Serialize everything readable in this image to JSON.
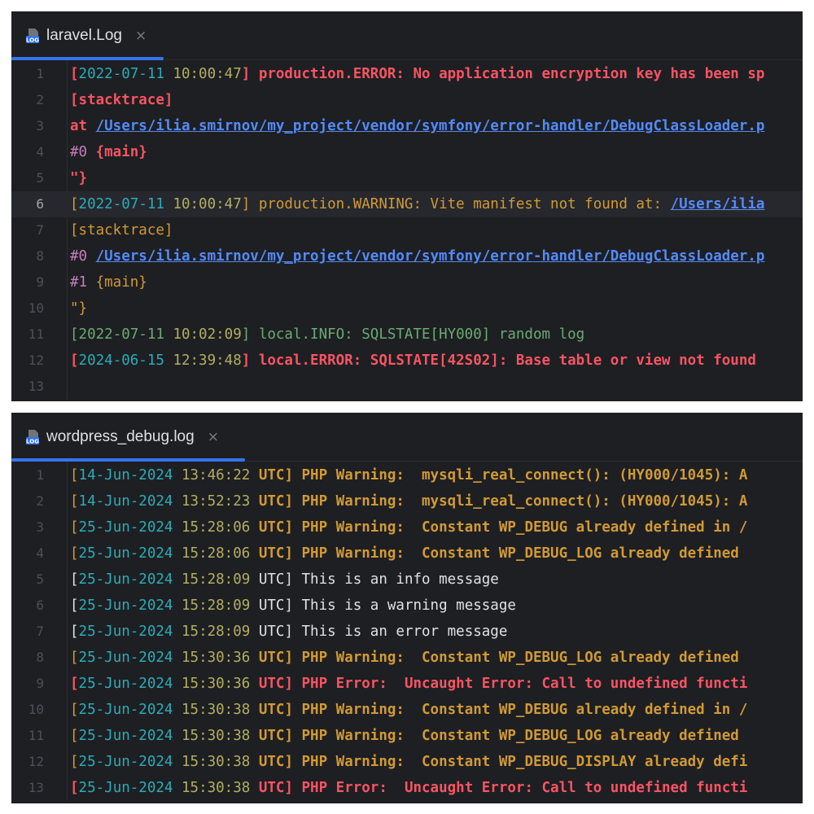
{
  "colors": {
    "panel_bg": "#1e1f22",
    "accent": "#3574f0",
    "error": "#f75464",
    "warning": "#d19a34",
    "info": "#6aab73",
    "date": "#2aacb8",
    "time": "#b3ae60",
    "link": "#548af7",
    "trace_purple": "#c77dbb",
    "plain": "#bcbec4"
  },
  "editors": [
    {
      "tab": {
        "icon": "log-file-icon",
        "name": "laravel.Log",
        "close": "×"
      },
      "current_line": 6,
      "lines": [
        {
          "n": "1",
          "segs": [
            {
              "t": "[",
              "c": "#f75464",
              "b": true
            },
            {
              "t": "2022-07-11",
              "c": "#2aacb8"
            },
            {
              "t": " ",
              "c": "#f75464"
            },
            {
              "t": "10:00:47",
              "c": "#b3ae60"
            },
            {
              "t": "] production.ERROR: No application encryption key has been sp",
              "c": "#f75464",
              "b": true
            }
          ]
        },
        {
          "n": "2",
          "segs": [
            {
              "t": "[stacktrace]",
              "c": "#f75464",
              "b": true
            }
          ]
        },
        {
          "n": "3",
          "segs": [
            {
              "t": "at ",
              "c": "#f75464",
              "b": true
            },
            {
              "t": "/Users/ilia.smirnov/my_project/vendor/symfony/error-handler/DebugClassLoader.p",
              "c": "#548af7",
              "u": true,
              "b": true
            }
          ]
        },
        {
          "n": "4",
          "segs": [
            {
              "t": "#0 ",
              "c": "#c77dbb"
            },
            {
              "t": "{main}",
              "c": "#f75464",
              "b": true
            }
          ]
        },
        {
          "n": "5",
          "segs": [
            {
              "t": "\"}",
              "c": "#f75464",
              "b": true
            }
          ]
        },
        {
          "n": "6",
          "segs": [
            {
              "t": "[",
              "c": "#d19a34"
            },
            {
              "t": "2022-07-11",
              "c": "#2aacb8"
            },
            {
              "t": " ",
              "c": "#d19a34"
            },
            {
              "t": "10:00:47",
              "c": "#b3ae60"
            },
            {
              "t": "] production.WARNING: Vite manifest not found at: ",
              "c": "#d19a34"
            },
            {
              "t": "/Users/ilia",
              "c": "#548af7",
              "u": true,
              "b": true
            }
          ]
        },
        {
          "n": "7",
          "segs": [
            {
              "t": "[stacktrace]",
              "c": "#d19a34"
            }
          ]
        },
        {
          "n": "8",
          "segs": [
            {
              "t": "#0 ",
              "c": "#c77dbb"
            },
            {
              "t": "/Users/ilia.smirnov/my_project/vendor/symfony/error-handler/DebugClassLoader.p",
              "c": "#548af7",
              "u": true,
              "b": true
            }
          ]
        },
        {
          "n": "9",
          "segs": [
            {
              "t": "#1 ",
              "c": "#c77dbb"
            },
            {
              "t": "{main}",
              "c": "#d19a34"
            }
          ]
        },
        {
          "n": "10",
          "segs": [
            {
              "t": "\"}",
              "c": "#d19a34"
            }
          ]
        },
        {
          "n": "11",
          "segs": [
            {
              "t": "[",
              "c": "#6aab73"
            },
            {
              "t": "2022-07-11",
              "c": "#6aab73"
            },
            {
              "t": " ",
              "c": "#6aab73"
            },
            {
              "t": "10:02:09",
              "c": "#b3ae60"
            },
            {
              "t": "] local.INFO: SQLSTATE[HY000] random log",
              "c": "#6aab73"
            }
          ]
        },
        {
          "n": "12",
          "segs": [
            {
              "t": "[",
              "c": "#f75464",
              "b": true
            },
            {
              "t": "2024-06-15",
              "c": "#2aacb8"
            },
            {
              "t": " ",
              "c": "#f75464"
            },
            {
              "t": "12:39:48",
              "c": "#b3ae60"
            },
            {
              "t": "] local.ERROR: SQLSTATE[42S02]: Base table or view not found",
              "c": "#f75464",
              "b": true
            }
          ]
        },
        {
          "n": "13",
          "segs": []
        }
      ]
    },
    {
      "tab": {
        "icon": "log-file-icon",
        "name": "wordpress_debug.log",
        "close": "×"
      },
      "current_line": 0,
      "lines": [
        {
          "n": "1",
          "segs": [
            {
              "t": "[",
              "c": "#d19a34"
            },
            {
              "t": "14-Jun-2024",
              "c": "#2aacb8"
            },
            {
              "t": " ",
              "c": "#d19a34"
            },
            {
              "t": "13:46:22",
              "c": "#b3ae60"
            },
            {
              "t": " UTC] PHP Warning:  mysqli_real_connect(): (HY000/1045): A",
              "c": "#d19a34",
              "b": true
            }
          ]
        },
        {
          "n": "2",
          "segs": [
            {
              "t": "[",
              "c": "#d19a34"
            },
            {
              "t": "14-Jun-2024",
              "c": "#2aacb8"
            },
            {
              "t": " ",
              "c": "#d19a34"
            },
            {
              "t": "13:52:23",
              "c": "#b3ae60"
            },
            {
              "t": " UTC] PHP Warning:  mysqli_real_connect(): (HY000/1045): A",
              "c": "#d19a34",
              "b": true
            }
          ]
        },
        {
          "n": "3",
          "segs": [
            {
              "t": "[",
              "c": "#d19a34"
            },
            {
              "t": "25-Jun-2024",
              "c": "#2aacb8"
            },
            {
              "t": " ",
              "c": "#d19a34"
            },
            {
              "t": "15:28:06",
              "c": "#b3ae60"
            },
            {
              "t": " UTC] PHP Warning:  Constant WP_DEBUG already defined in /",
              "c": "#d19a34",
              "b": true
            }
          ]
        },
        {
          "n": "4",
          "segs": [
            {
              "t": "[",
              "c": "#d19a34"
            },
            {
              "t": "25-Jun-2024",
              "c": "#2aacb8"
            },
            {
              "t": " ",
              "c": "#d19a34"
            },
            {
              "t": "15:28:06",
              "c": "#b3ae60"
            },
            {
              "t": " UTC] PHP Warning:  Constant WP_DEBUG_LOG already defined ",
              "c": "#d19a34",
              "b": true
            }
          ]
        },
        {
          "n": "5",
          "segs": [
            {
              "t": "[",
              "c": "#dfe1e5"
            },
            {
              "t": "25-Jun-2024",
              "c": "#2aacb8"
            },
            {
              "t": " ",
              "c": "#dfe1e5"
            },
            {
              "t": "15:28:09",
              "c": "#b3ae60"
            },
            {
              "t": " UTC] This is an info message",
              "c": "#dfe1e5"
            }
          ]
        },
        {
          "n": "6",
          "segs": [
            {
              "t": "[",
              "c": "#dfe1e5"
            },
            {
              "t": "25-Jun-2024",
              "c": "#2aacb8"
            },
            {
              "t": " ",
              "c": "#dfe1e5"
            },
            {
              "t": "15:28:09",
              "c": "#b3ae60"
            },
            {
              "t": " UTC] This is a warning message",
              "c": "#dfe1e5"
            }
          ]
        },
        {
          "n": "7",
          "segs": [
            {
              "t": "[",
              "c": "#dfe1e5"
            },
            {
              "t": "25-Jun-2024",
              "c": "#2aacb8"
            },
            {
              "t": " ",
              "c": "#dfe1e5"
            },
            {
              "t": "15:28:09",
              "c": "#b3ae60"
            },
            {
              "t": " UTC] This is an error message",
              "c": "#dfe1e5"
            }
          ]
        },
        {
          "n": "8",
          "segs": [
            {
              "t": "[",
              "c": "#d19a34"
            },
            {
              "t": "25-Jun-2024",
              "c": "#2aacb8"
            },
            {
              "t": " ",
              "c": "#d19a34"
            },
            {
              "t": "15:30:36",
              "c": "#b3ae60"
            },
            {
              "t": " UTC] PHP Warning:  Constant WP_DEBUG_LOG already defined ",
              "c": "#d19a34",
              "b": true
            }
          ]
        },
        {
          "n": "9",
          "segs": [
            {
              "t": "[",
              "c": "#f75464",
              "b": true
            },
            {
              "t": "25-Jun-2024",
              "c": "#2aacb8"
            },
            {
              "t": " ",
              "c": "#f75464"
            },
            {
              "t": "15:30:36",
              "c": "#b3ae60"
            },
            {
              "t": " UTC] PHP Error:  Uncaught Error: Call to undefined functi",
              "c": "#f75464",
              "b": true
            }
          ]
        },
        {
          "n": "10",
          "segs": [
            {
              "t": "[",
              "c": "#d19a34"
            },
            {
              "t": "25-Jun-2024",
              "c": "#2aacb8"
            },
            {
              "t": " ",
              "c": "#d19a34"
            },
            {
              "t": "15:30:38",
              "c": "#b3ae60"
            },
            {
              "t": " UTC] PHP Warning:  Constant WP_DEBUG already defined in /",
              "c": "#d19a34",
              "b": true
            }
          ]
        },
        {
          "n": "11",
          "segs": [
            {
              "t": "[",
              "c": "#d19a34"
            },
            {
              "t": "25-Jun-2024",
              "c": "#2aacb8"
            },
            {
              "t": " ",
              "c": "#d19a34"
            },
            {
              "t": "15:30:38",
              "c": "#b3ae60"
            },
            {
              "t": " UTC] PHP Warning:  Constant WP_DEBUG_LOG already defined ",
              "c": "#d19a34",
              "b": true
            }
          ]
        },
        {
          "n": "12",
          "segs": [
            {
              "t": "[",
              "c": "#d19a34"
            },
            {
              "t": "25-Jun-2024",
              "c": "#2aacb8"
            },
            {
              "t": " ",
              "c": "#d19a34"
            },
            {
              "t": "15:30:38",
              "c": "#b3ae60"
            },
            {
              "t": " UTC] PHP Warning:  Constant WP_DEBUG_DISPLAY already defi",
              "c": "#d19a34",
              "b": true
            }
          ]
        },
        {
          "n": "13",
          "segs": [
            {
              "t": "[",
              "c": "#f75464",
              "b": true
            },
            {
              "t": "25-Jun-2024",
              "c": "#2aacb8"
            },
            {
              "t": " ",
              "c": "#f75464"
            },
            {
              "t": "15:30:38",
              "c": "#b3ae60"
            },
            {
              "t": " UTC] PHP Error:  Uncaught Error: Call to undefined functi",
              "c": "#f75464",
              "b": true
            }
          ]
        }
      ]
    }
  ]
}
